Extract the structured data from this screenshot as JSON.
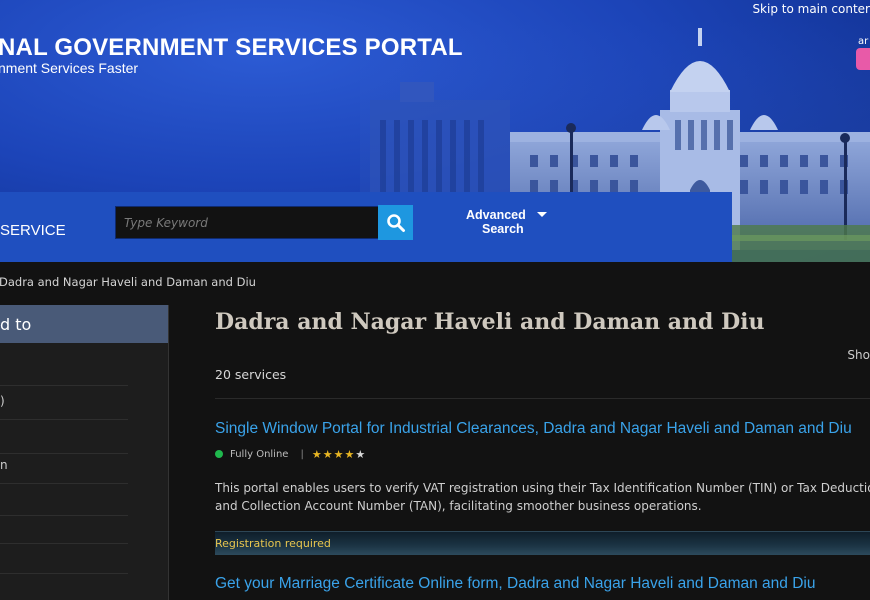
{
  "header": {
    "skip_link": "Skip to main conter",
    "title": "NAL GOVERNMENT SERVICES PORTAL",
    "subtitle": "nment Services Faster",
    "logo_fragment": "ar",
    "bg_color": "#1c44b8"
  },
  "search": {
    "service_label": "SERVICE",
    "placeholder": "Type Keyword",
    "search_icon": "search-icon",
    "advanced_line1": "Advanced",
    "advanced_line2": "Search"
  },
  "breadcrumb": {
    "text": "Dadra and Nagar Haveli and Daman and Diu"
  },
  "sidebar": {
    "header": "d to",
    "items": [
      {
        "label": ""
      },
      {
        "label": ")"
      },
      {
        "label": ""
      },
      {
        "label": "n"
      },
      {
        "label": ""
      },
      {
        "label": ""
      },
      {
        "label": ""
      }
    ]
  },
  "main": {
    "title": "Dadra and Nagar Haveli and Daman and Diu",
    "show_label": "Sho",
    "count": "20 services",
    "services": [
      {
        "title": "Single Window Portal for Industrial Clearances, Dadra and Nagar Haveli and Daman and Diu",
        "status": "Fully Online",
        "status_color": "#1fb84d",
        "rating": 4,
        "rating_max": 5,
        "description": "This portal enables users to verify VAT registration using their Tax Identification Number (TIN) or Tax Deduction and Collection Account Number (TAN), facilitating smoother business operations.",
        "registration": "Registration required"
      },
      {
        "title": "Get your Marriage Certificate Online form, Dadra and Nagar Haveli and Daman and Diu"
      }
    ]
  }
}
